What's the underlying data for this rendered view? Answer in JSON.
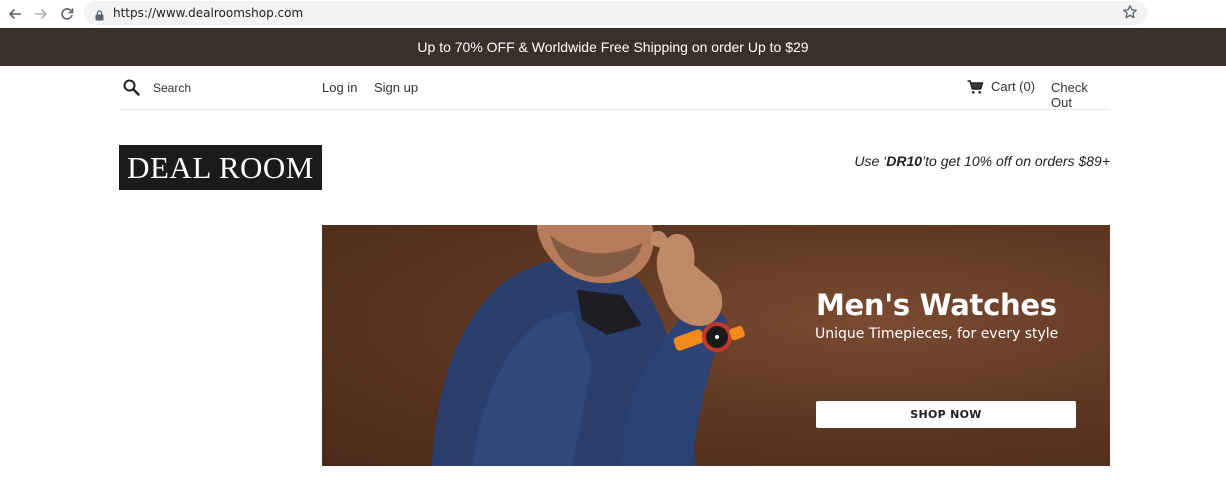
{
  "browser": {
    "url": "https://www.dealroomshop.com"
  },
  "announcement": {
    "text": "Up to 70% OFF & Worldwide Free Shipping on order Up to $29"
  },
  "header": {
    "search_placeholder": "Search",
    "login_label": "Log in",
    "signup_label": "Sign up",
    "cart_label": "Cart (0)",
    "checkout_label": "Check Out"
  },
  "brand": {
    "logo_text": "DEAL ROOM"
  },
  "promo": {
    "prefix": "Use ‘",
    "code": "DR10",
    "suffix": "’to get 10% off on orders  $89+"
  },
  "hero": {
    "title": "Men's Watches",
    "subtitle": "Unique Timepieces, for every style",
    "cta_label": "SHOP NOW"
  },
  "colors": {
    "announcement_bg": "#3b2f29",
    "hero_bg": "#5f3823",
    "logo_bg": "#1b1b1b",
    "watch_strap": "#f28a1c"
  }
}
